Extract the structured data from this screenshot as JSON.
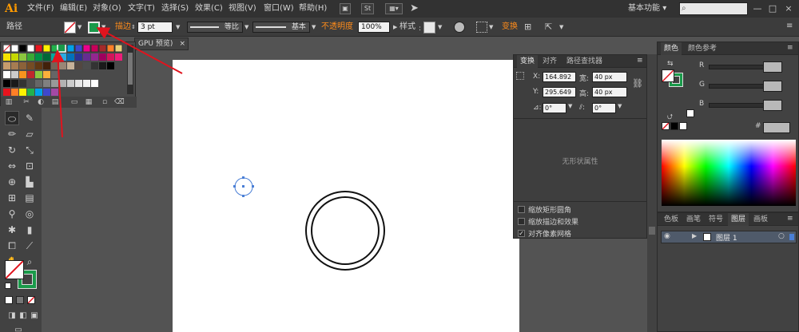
{
  "app": {
    "logo": "Ai"
  },
  "menu": {
    "items": [
      "文件(F)",
      "编辑(E)",
      "对象(O)",
      "文字(T)",
      "选择(S)",
      "效果(C)",
      "视图(V)",
      "窗口(W)",
      "帮助(H)"
    ],
    "btn_st": "St",
    "workspace": "基本功能",
    "workspace_arrow": "▾"
  },
  "control": {
    "object_label": "路径",
    "stroke_label": "描边",
    "stroke_value": "3 pt",
    "profile_label": "等比",
    "brush_label": "基本",
    "opacity_label": "不透明度",
    "opacity_value": "100%",
    "style_label": "样式",
    "transform_label": "变换"
  },
  "document": {
    "tab_label": "GPU 预览)"
  },
  "transform_panel": {
    "tabs": [
      "变换",
      "对齐",
      "路径查找器"
    ],
    "x_label": "X:",
    "x_value": "164.892",
    "y_label": "Y:",
    "y_value": "295.649",
    "w_label": "宽:",
    "w_value": "40 px",
    "h_label": "高:",
    "h_value": "40 px",
    "angle_value": "0°",
    "shear_value": "0°",
    "no_shape_text": "无形状属性",
    "checkbox_scale_corners": "缩放矩形圆角",
    "checkbox_scale_strokes": "缩放描边和效果",
    "checkbox_align_pixel": "对齐像素网格",
    "align_pixel_checked": "✓"
  },
  "color_panel": {
    "tabs": [
      "颜色",
      "颜色参考"
    ],
    "r_label": "R",
    "g_label": "G",
    "b_label": "B"
  },
  "layers_panel": {
    "tabs": [
      "色板",
      "画笔",
      "符号",
      "图层",
      "画板"
    ],
    "layer_name": "图层 1"
  },
  "colors": {
    "accent_orange": "#ff8c1a",
    "arrow_red": "#e0141e",
    "fill_green": "#1a9a4a"
  },
  "icons": {
    "close": "×",
    "menu": "≡",
    "minimize": "—",
    "maximize": "□",
    "search": "⌕"
  }
}
